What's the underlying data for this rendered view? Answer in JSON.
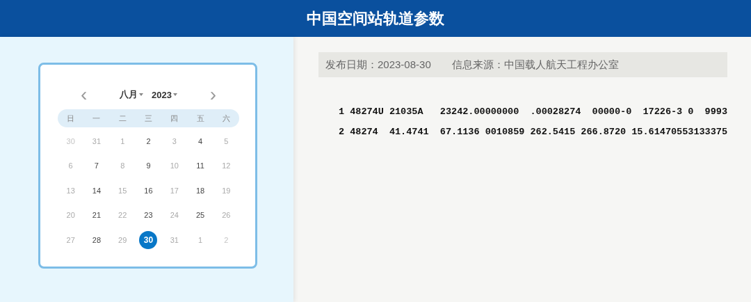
{
  "header": {
    "title": "中国空间站轨道参数"
  },
  "calendar": {
    "month": "八月",
    "year": "2023",
    "prev": "‹",
    "next": "›",
    "weekdays": [
      "日",
      "一",
      "二",
      "三",
      "四",
      "五",
      "六"
    ],
    "days": [
      {
        "label": "30",
        "kind": "faint",
        "selected": false
      },
      {
        "label": "31",
        "kind": "inactive",
        "selected": false
      },
      {
        "label": "1",
        "kind": "inactive",
        "selected": false
      },
      {
        "label": "2",
        "kind": "active",
        "selected": false
      },
      {
        "label": "3",
        "kind": "inactive",
        "selected": false
      },
      {
        "label": "4",
        "kind": "active",
        "selected": false
      },
      {
        "label": "5",
        "kind": "inactive",
        "selected": false
      },
      {
        "label": "6",
        "kind": "inactive",
        "selected": false
      },
      {
        "label": "7",
        "kind": "active",
        "selected": false
      },
      {
        "label": "8",
        "kind": "inactive",
        "selected": false
      },
      {
        "label": "9",
        "kind": "active",
        "selected": false
      },
      {
        "label": "10",
        "kind": "inactive",
        "selected": false
      },
      {
        "label": "11",
        "kind": "active",
        "selected": false
      },
      {
        "label": "12",
        "kind": "inactive",
        "selected": false
      },
      {
        "label": "13",
        "kind": "inactive",
        "selected": false
      },
      {
        "label": "14",
        "kind": "active",
        "selected": false
      },
      {
        "label": "15",
        "kind": "inactive",
        "selected": false
      },
      {
        "label": "16",
        "kind": "active",
        "selected": false
      },
      {
        "label": "17",
        "kind": "inactive",
        "selected": false
      },
      {
        "label": "18",
        "kind": "active",
        "selected": false
      },
      {
        "label": "19",
        "kind": "inactive",
        "selected": false
      },
      {
        "label": "20",
        "kind": "inactive",
        "selected": false
      },
      {
        "label": "21",
        "kind": "active",
        "selected": false
      },
      {
        "label": "22",
        "kind": "inactive",
        "selected": false
      },
      {
        "label": "23",
        "kind": "active",
        "selected": false
      },
      {
        "label": "24",
        "kind": "inactive",
        "selected": false
      },
      {
        "label": "25",
        "kind": "active",
        "selected": false
      },
      {
        "label": "26",
        "kind": "inactive",
        "selected": false
      },
      {
        "label": "27",
        "kind": "inactive",
        "selected": false
      },
      {
        "label": "28",
        "kind": "active",
        "selected": false
      },
      {
        "label": "29",
        "kind": "inactive",
        "selected": false
      },
      {
        "label": "30",
        "kind": "active",
        "selected": true
      },
      {
        "label": "31",
        "kind": "inactive",
        "selected": false
      },
      {
        "label": "1",
        "kind": "inactive",
        "selected": false
      },
      {
        "label": "2",
        "kind": "faint",
        "selected": false
      }
    ]
  },
  "info": {
    "date": "发布日期：2023-08-30",
    "source": "信息来源：中国载人航天工程办公室"
  },
  "tle_lines": [
    "1 48274U 21035A   23242.00000000  .00028274  00000-0  17226-3 0  9993",
    "2 48274  41.4741  67.1136 0010859 262.5415 266.8720 15.61470553133375"
  ]
}
